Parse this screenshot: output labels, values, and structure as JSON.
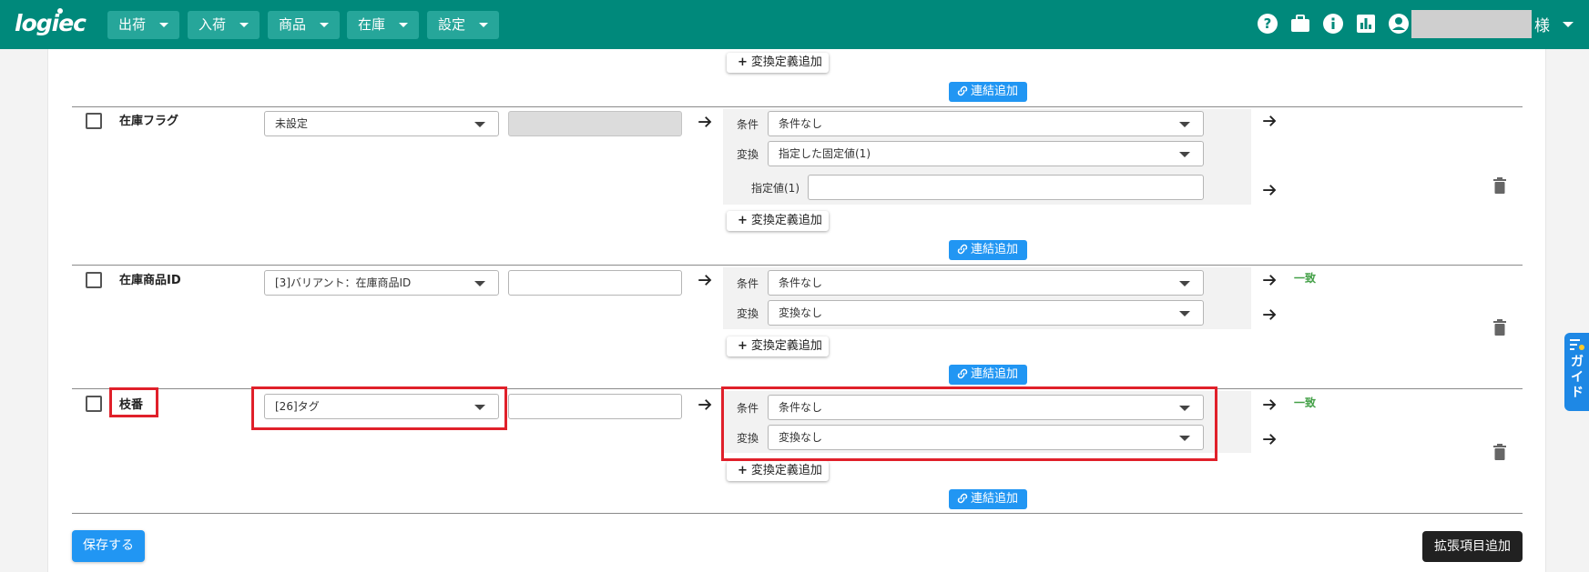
{
  "header": {
    "logo": "logiec",
    "nav": [
      {
        "label": "出荷"
      },
      {
        "label": "入荷"
      },
      {
        "label": "商品"
      },
      {
        "label": "在庫"
      },
      {
        "label": "設定"
      }
    ],
    "icons": [
      "help-icon",
      "briefcase-icon",
      "info-icon",
      "chart-icon",
      "account-icon"
    ],
    "user_suffix": "様"
  },
  "common": {
    "add_definition": "変換定義追加",
    "add_link": "連結追加",
    "cond_label": "条件",
    "conv_label": "変換",
    "match": "一致"
  },
  "rows": [
    {
      "label": "在庫フラグ",
      "source": "未設定",
      "condition": "条件なし",
      "conversion": "指定した固定値(1)",
      "param_label": "指定値(1)"
    },
    {
      "label": "在庫商品ID",
      "source": "[3]バリアント：在庫商品ID",
      "condition": "条件なし",
      "conversion": "変換なし"
    },
    {
      "label": "枝番",
      "source": "[26]タグ",
      "condition": "条件なし",
      "conversion": "変換なし"
    }
  ],
  "footer": {
    "save": "保存する",
    "add_extension": "拡張項目追加"
  },
  "guide": "ガイド",
  "colors": {
    "header": "#00897b",
    "primary": "#2196f3",
    "highlight": "#e0202a",
    "match": "#43a047"
  }
}
